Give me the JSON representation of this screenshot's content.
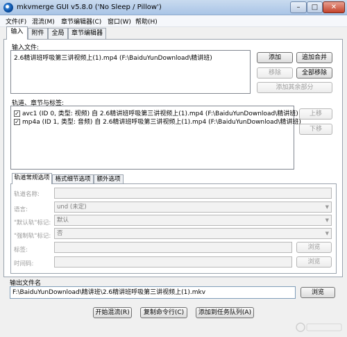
{
  "window": {
    "title": "mkvmerge GUI v5.8.0 ('No Sleep / Pillow')",
    "minimize": "–",
    "maximize": "□",
    "close": "✕"
  },
  "menu": [
    "文件(F)",
    "混流(M)",
    "章节编辑器(C)",
    "窗口(W)",
    "帮助(H)"
  ],
  "tabs": [
    "输入",
    "附件",
    "全局",
    "章节编辑器"
  ],
  "input_files": {
    "label": "输入文件:",
    "items": [
      "2.6精讲班呼吸第三讲视频上(1).mp4 (F:\\BaiduYunDownload\\精讲班)"
    ],
    "buttons": {
      "add": "添加",
      "append": "追加合并",
      "remove": "移除",
      "remove_all": "全部移除",
      "additional_parts": "添加其余部分"
    }
  },
  "tracks": {
    "label": "轨道、章节与标签:",
    "items": [
      {
        "checked": "✓",
        "text": "avc1 (ID 0, 类型: 视频) 自 2.6精讲班呼吸第三讲视频上(1).mp4 (F:\\BaiduYunDownload\\精讲班)"
      },
      {
        "checked": "✓",
        "text": "mp4a (ID 1, 类型: 音频) 自 2.6精讲班呼吸第三讲视频上(1).mp4 (F:\\BaiduYunDownload\\精讲班)"
      }
    ],
    "up": "上移",
    "down": "下移"
  },
  "subtabs": [
    "轨道常规选项",
    "格式细节选项",
    "额外选项"
  ],
  "general_options": {
    "track_name_label": "轨道名称:",
    "language_label": "语言:",
    "language_value": "und (未定)",
    "default_flag_label": "\"默认轨\"标记:",
    "default_flag_value": "默认",
    "forced_flag_label": "\"强制轨\"标记:",
    "forced_flag_value": "否",
    "tags_label": "标签:",
    "timecodes_label": "时间码:",
    "browse": "浏览"
  },
  "output": {
    "label": "输出文件名",
    "value": "F:\\BaiduYunDownload\\精讲班\\2.6精讲班呼吸第三讲视频上(1).mkv",
    "browse": "浏览"
  },
  "bottom_buttons": {
    "start": "开始混流(R)",
    "copy_cmd": "复制命令行(C)",
    "add_job": "添加到任务队列(A)"
  }
}
